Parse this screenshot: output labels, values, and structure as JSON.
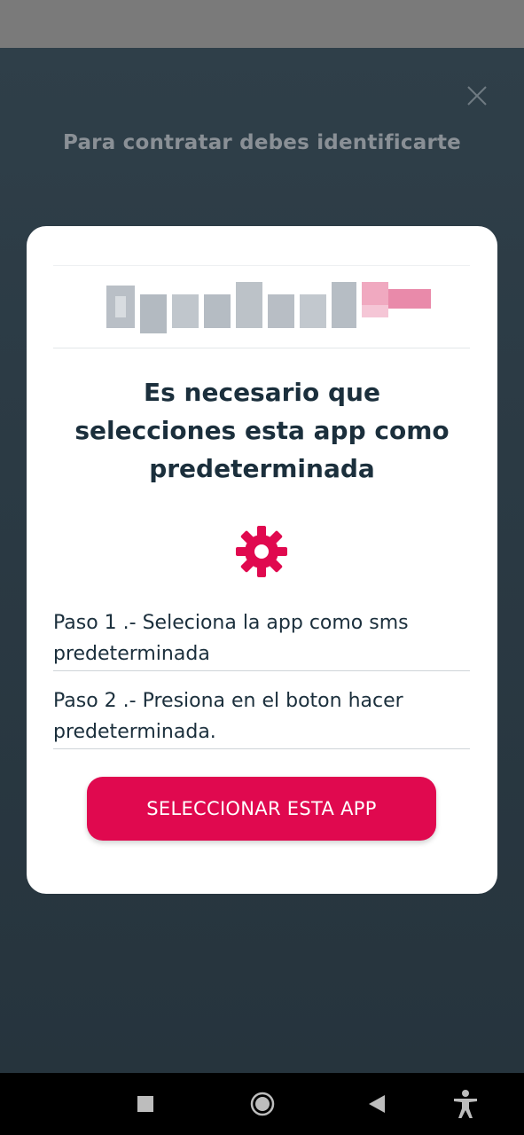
{
  "background": {
    "title": "Para contratar debes identificarte"
  },
  "modal": {
    "logo_text": "Openbank",
    "title": "Es necesario que selecciones esta app como predeterminada",
    "steps": [
      "Paso 1 .- Seleciona la app como sms predeterminada",
      "Paso 2 .- Presiona en el boton  hacer predeterminada."
    ],
    "button_label": "SELECCIONAR ESTA APP"
  },
  "colors": {
    "accent": "#e0094f",
    "text_dark": "#1b2f3c",
    "background": "#2c3a44"
  },
  "icons": {
    "close": "close-icon",
    "settings": "gear-icon",
    "nav": [
      "recents-icon",
      "home-icon",
      "back-icon",
      "accessibility-icon"
    ]
  }
}
